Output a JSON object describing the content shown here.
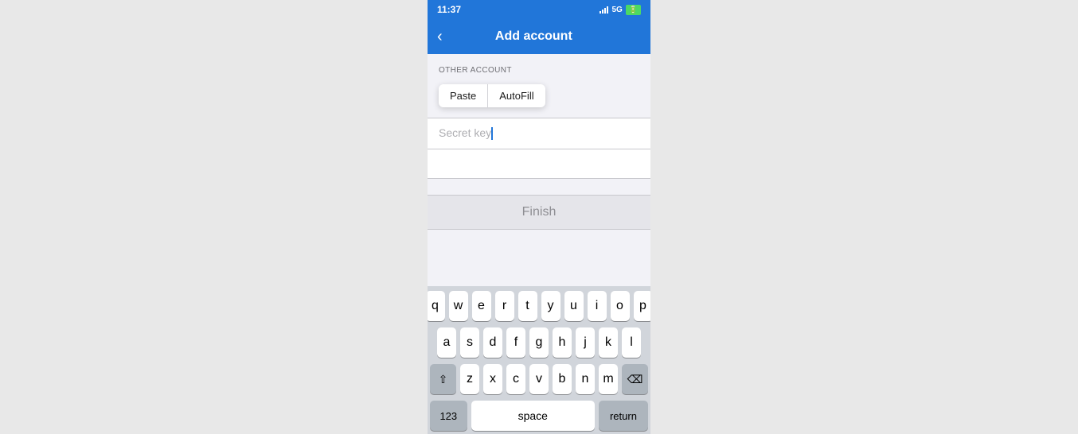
{
  "status_bar": {
    "time": "11:37",
    "signal_label": "signal",
    "network": "5G",
    "battery_label": "battery"
  },
  "nav": {
    "back_icon": "‹",
    "title": "Add account"
  },
  "section": {
    "label": "OTHER ACCOUNT"
  },
  "tooltip": {
    "paste_label": "Paste",
    "autofill_label": "AutoFill"
  },
  "inputs": {
    "secret_key_placeholder": "Secret key",
    "issuer_placeholder": ""
  },
  "finish_button": {
    "label": "Finish"
  },
  "keyboard": {
    "row1": [
      "q",
      "w",
      "e",
      "r",
      "t",
      "y",
      "u",
      "i",
      "o",
      "p"
    ],
    "row2": [
      "a",
      "s",
      "d",
      "f",
      "g",
      "h",
      "j",
      "k",
      "l"
    ],
    "row3": [
      "z",
      "x",
      "c",
      "v",
      "b",
      "n",
      "m"
    ],
    "num_label": "123",
    "space_label": "space",
    "return_label": "return",
    "shift_icon": "⇧",
    "delete_icon": "⌫"
  }
}
